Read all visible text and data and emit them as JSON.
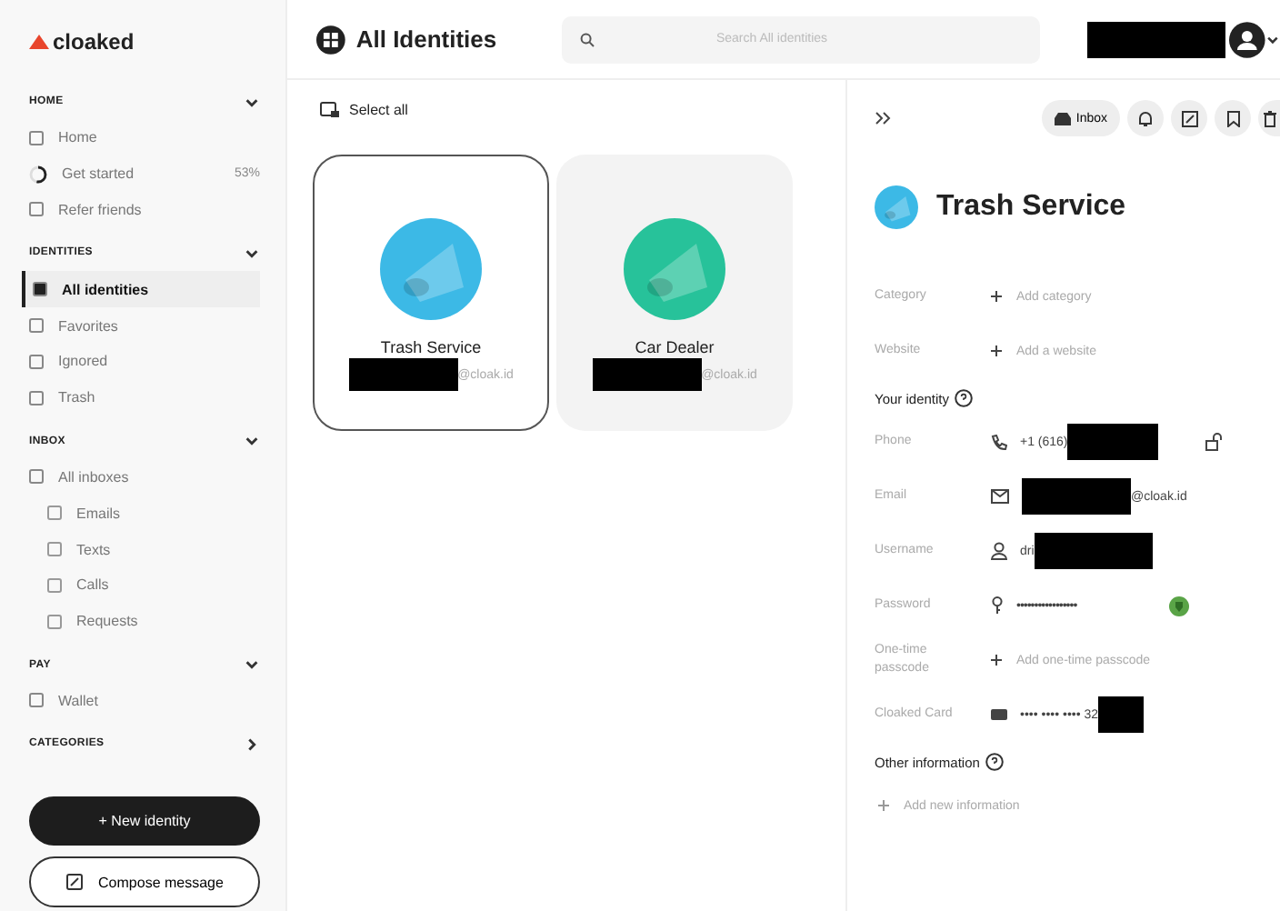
{
  "brand": "cloaked",
  "sidebar": {
    "sections": [
      {
        "title": "HOME",
        "expanded": true,
        "items": [
          {
            "label": "Home",
            "selected": false
          },
          {
            "label": "Get started",
            "selected": false,
            "badge": "53%",
            "level": 0.53
          },
          {
            "label": "Refer friends",
            "selected": false
          }
        ]
      },
      {
        "title": "IDENTITIES",
        "expanded": true,
        "items": [
          {
            "label": "All identities",
            "selected": true
          },
          {
            "label": "Favorites",
            "selected": false
          },
          {
            "label": "Ignored",
            "selected": false
          },
          {
            "label": "Trash",
            "selected": false
          }
        ]
      },
      {
        "title": "INBOX",
        "expanded": true,
        "items": [
          {
            "label": "All inboxes",
            "selected": false,
            "children": [
              {
                "label": "Emails",
                "selected": false
              },
              {
                "label": "Texts",
                "selected": false
              },
              {
                "label": "Calls",
                "selected": false
              },
              {
                "label": "Requests",
                "selected": false
              }
            ]
          }
        ]
      },
      {
        "title": "PAY",
        "expanded": true,
        "items": [
          {
            "label": "Wallet",
            "selected": false
          }
        ]
      },
      {
        "title": "CATEGORIES",
        "expanded": false
      }
    ]
  },
  "buttons": {
    "new_identity": "+ New identity",
    "compose": "Compose message"
  },
  "header": {
    "title": "All Identities",
    "search_placeholder": "Search All identities"
  },
  "select_all": "Select all",
  "identities": [
    {
      "name": "Trash Service",
      "email_suffix": "@cloak.id",
      "selected": true,
      "color": "#3cb9e6"
    },
    {
      "name": "Car Dealer",
      "email_suffix": "@cloak.id",
      "selected": false,
      "color": "#27c29a"
    }
  ],
  "detail": {
    "inbox_label": "Inbox",
    "title": "Trash Service",
    "fields": [
      {
        "kind": "add",
        "label": "Category",
        "value": "Add category"
      },
      {
        "kind": "add",
        "label": "Website",
        "value": "Add a website"
      },
      {
        "kind": "heading",
        "label": "Your identity"
      },
      {
        "kind": "phone",
        "label": "Phone",
        "value": "+1 (616)"
      },
      {
        "kind": "email",
        "label": "Email",
        "value": "@cloak.id"
      },
      {
        "kind": "username",
        "label": "Username",
        "value": "dri"
      },
      {
        "kind": "password",
        "label": "Password",
        "value": "•••••••••••••••••"
      },
      {
        "kind": "add",
        "label": "One-time passcode",
        "value": "Add one-time passcode"
      },
      {
        "kind": "card",
        "label": "Cloaked Card",
        "value": "•••• •••• •••• 32"
      },
      {
        "kind": "heading",
        "label": "Other information"
      },
      {
        "kind": "addonly",
        "value": "Add new information"
      }
    ]
  }
}
